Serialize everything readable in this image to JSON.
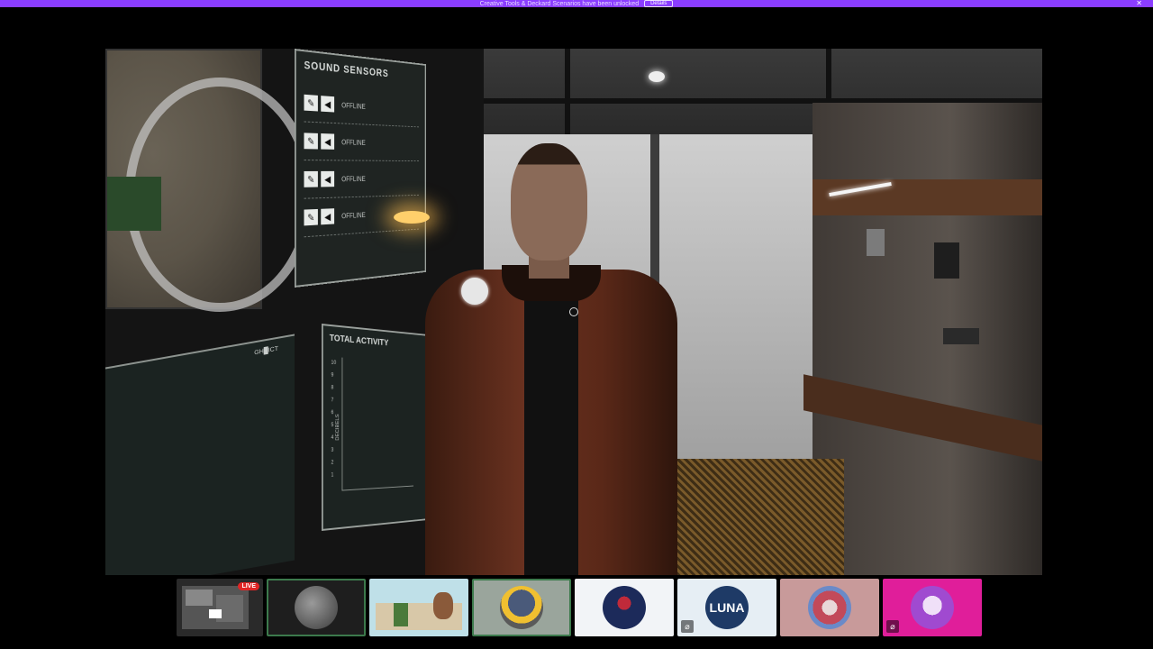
{
  "banner": {
    "text": "Creative Tools & Deckard Scenarios have been unlocked",
    "button_label": "Details",
    "close_icon": "close-icon",
    "color": "#8b3dff"
  },
  "game": {
    "sensor_panel": {
      "title": "SOUND SENSORS",
      "rows": [
        {
          "status": "OFFLINE"
        },
        {
          "status": "OFFLINE"
        },
        {
          "status": "OFFLINE"
        },
        {
          "status": "OFFLINE"
        }
      ],
      "edit_icon": "pencil-icon",
      "speaker_icon": "speaker-icon"
    },
    "activity_panel": {
      "title": "TOTAL ACTIVITY",
      "ticks": [
        "10",
        "9",
        "8",
        "7",
        "6",
        "5",
        "4",
        "3",
        "2",
        "1"
      ],
      "ylabel": "DECIBELS"
    },
    "lower_screen_label": "GH█ICT"
  },
  "participants": {
    "self": {
      "live_label": "LIVE"
    },
    "tiles": [
      {
        "name": "participant-moon",
        "bg": "#1e1e1e",
        "avatar_color": "#6a6a6a",
        "active": true
      },
      {
        "name": "participant-office",
        "bg": "#bfe0e8",
        "avatar_color": "#c89a6a",
        "active": false
      },
      {
        "name": "participant-worker",
        "bg": "#9aa59c",
        "avatar_color": "#f0c030",
        "active": true
      },
      {
        "name": "participant-astronaut",
        "bg": "#f2f4f7",
        "avatar_color": "#1c2a5a",
        "active": false
      },
      {
        "name": "participant-luna",
        "bg": "#e6eef4",
        "avatar_color": "#1e3a66",
        "text": "LUNA",
        "muted": true
      },
      {
        "name": "participant-demon",
        "bg": "#c89a9a",
        "avatar_color": "#c24a5a",
        "active": false
      },
      {
        "name": "participant-skull",
        "bg": "#e01e9a",
        "avatar_color": "#a04ad0",
        "muted": true
      }
    ],
    "muted_icon": "mic-off-icon"
  }
}
